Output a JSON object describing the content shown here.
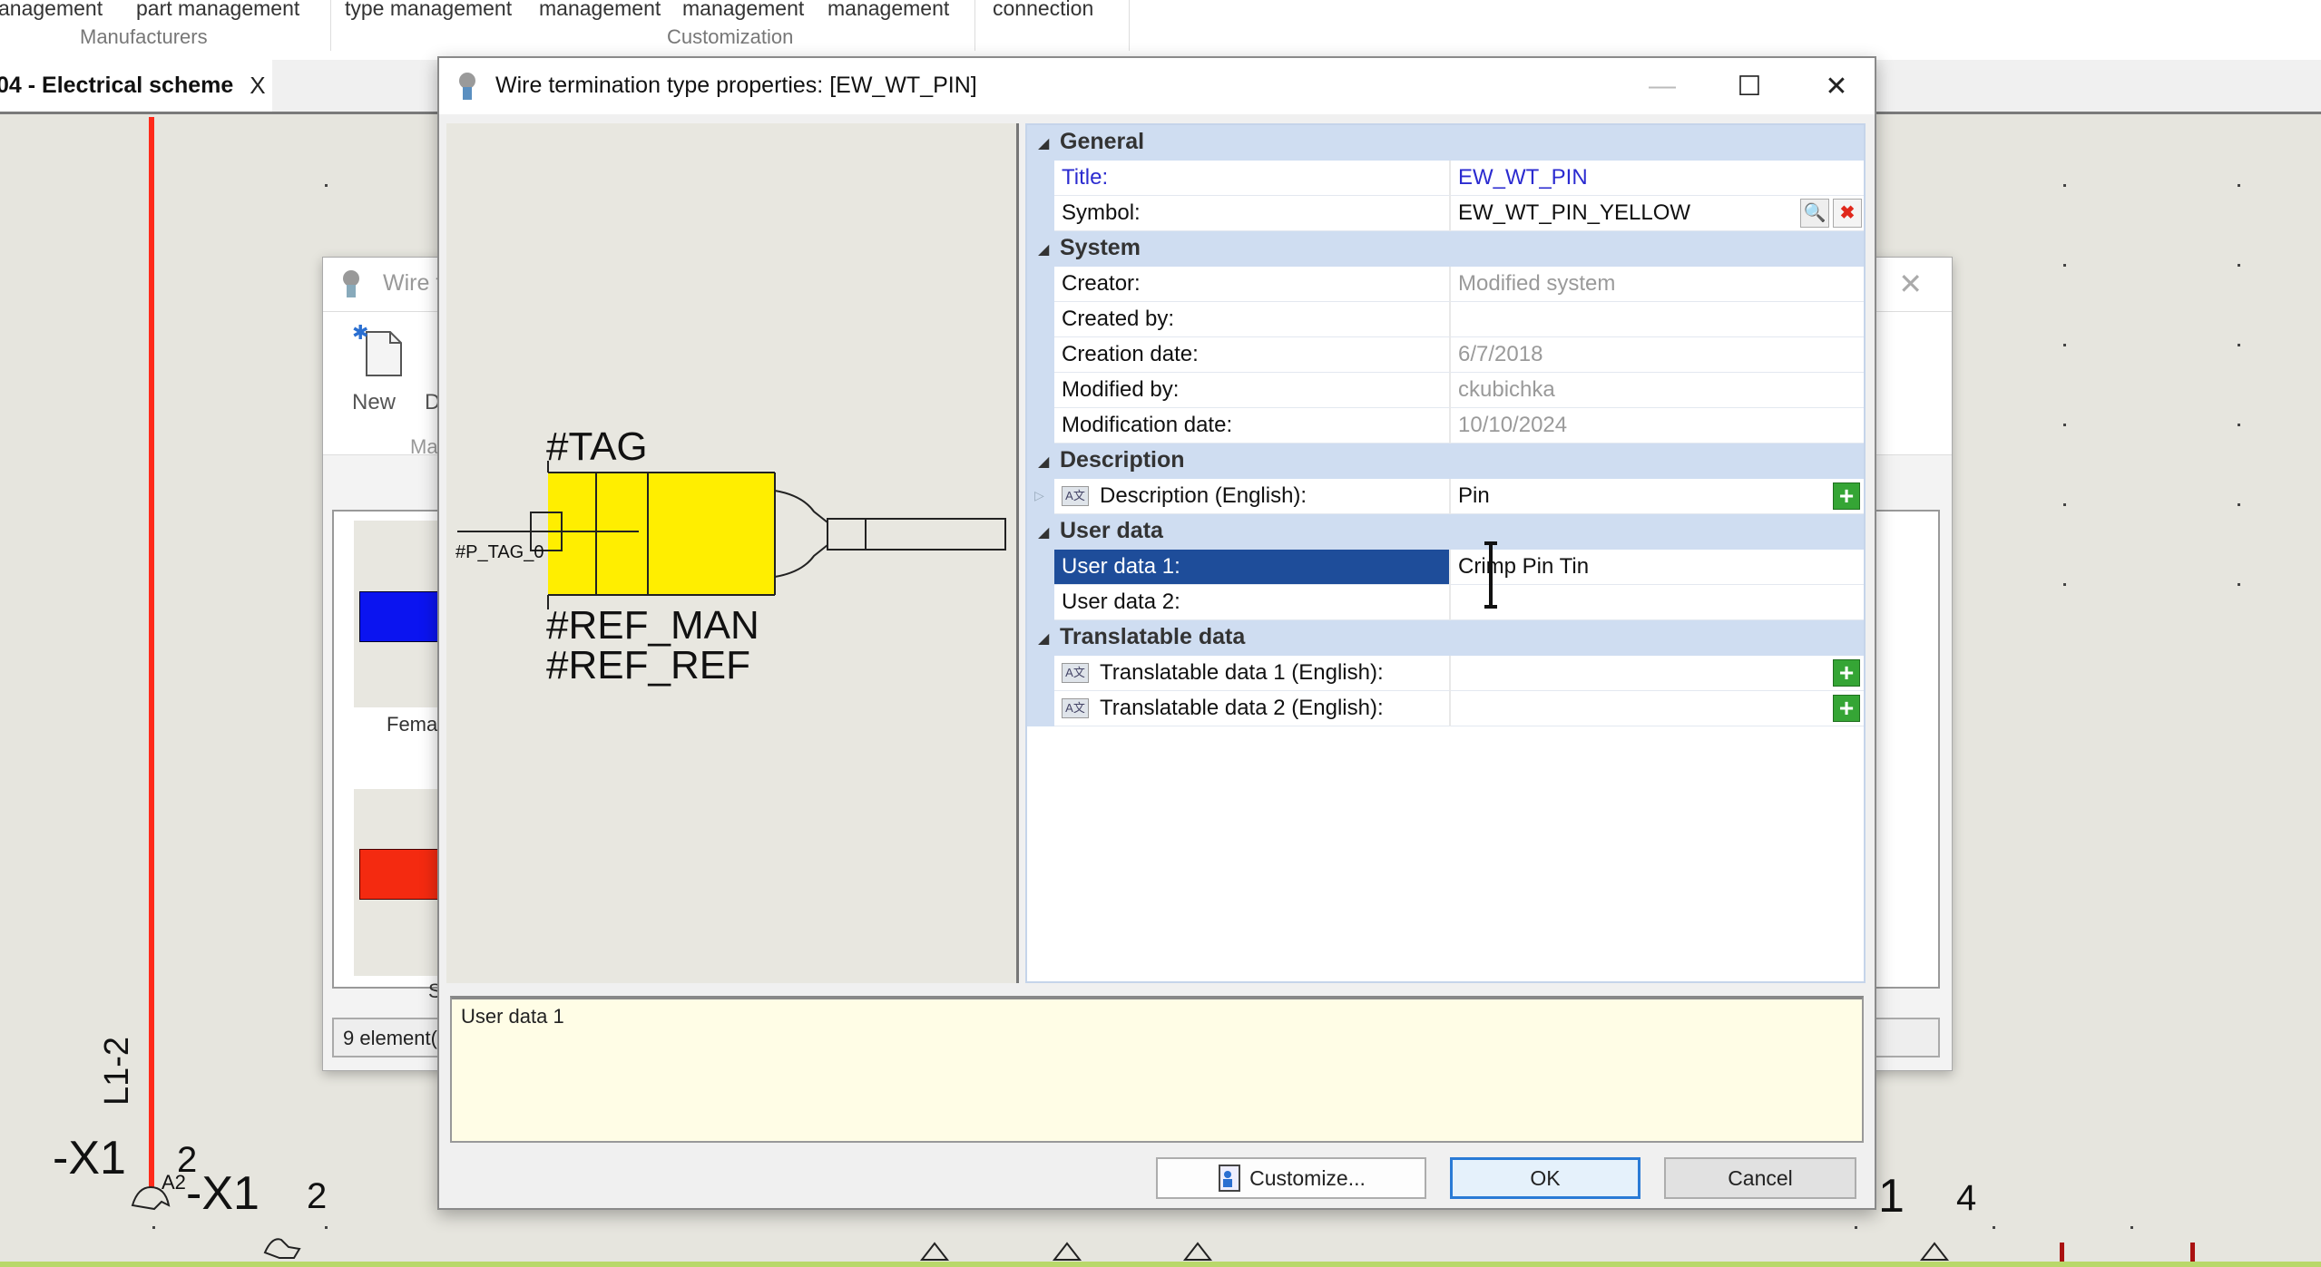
{
  "ribbon": {
    "labels": [
      "anagement",
      "part management",
      "type management",
      "management",
      "management",
      "management",
      "connection"
    ],
    "groups": [
      "Manufacturers",
      "Customization"
    ]
  },
  "doc_tab": {
    "title": "04 - Electrical scheme",
    "close": "X"
  },
  "schematic": {
    "wire_label": "L1-2",
    "labels": [
      "-X1",
      "2",
      "A2",
      "-X1",
      "2",
      "1",
      "4"
    ]
  },
  "background_dialog": {
    "title": "Wire t",
    "new_label": "New",
    "d_label": "D",
    "group_label": "Ma",
    "items": [
      "Femal",
      "Sp"
    ],
    "status": "9 element("
  },
  "dialog": {
    "title": "Wire termination type properties: [EW_WT_PIN]",
    "window_controls": {
      "minimize": "—",
      "maximize": "☐",
      "close": "✕"
    },
    "preview": {
      "tag": "#TAG",
      "p_tag": "#P_TAG_0",
      "ref_man": "#REF_MAN",
      "ref_ref": "#REF_REF",
      "fill_color": "#ffee00"
    },
    "grid": {
      "categories": [
        {
          "name": "General",
          "rows": [
            {
              "label": "Title:",
              "value": "EW_WT_PIN",
              "style": "blue"
            },
            {
              "label": "Symbol:",
              "value": "EW_WT_PIN_YELLOW",
              "style": "symbol"
            }
          ]
        },
        {
          "name": "System",
          "rows": [
            {
              "label": "Creator:",
              "value": "Modified system",
              "style": "muted"
            },
            {
              "label": "Created by:",
              "value": "",
              "style": "muted"
            },
            {
              "label": "Creation date:",
              "value": "6/7/2018",
              "style": "muted"
            },
            {
              "label": "Modified by:",
              "value": "ckubichka",
              "style": "muted"
            },
            {
              "label": "Modification date:",
              "value": "10/10/2024",
              "style": "muted"
            }
          ]
        },
        {
          "name": "Description",
          "rows": [
            {
              "label": "Description (English):",
              "value": "Pin",
              "style": "translatable"
            }
          ]
        },
        {
          "name": "User data",
          "rows": [
            {
              "label": "User data 1:",
              "value": "Crimp Pin Tin",
              "style": "selected"
            },
            {
              "label": "User data 2:",
              "value": "",
              "style": "normal"
            }
          ]
        },
        {
          "name": "Translatable data",
          "rows": [
            {
              "label": "Translatable data 1 (English):",
              "value": "",
              "style": "translatable"
            },
            {
              "label": "Translatable data 2 (English):",
              "value": "",
              "style": "translatable"
            }
          ]
        }
      ]
    },
    "help_text": "User data 1",
    "buttons": {
      "customize": "Customize...",
      "ok": "OK",
      "cancel": "Cancel"
    }
  },
  "colors": {
    "accent_selected": "#1e4d9a",
    "category_bg": "#cfddf1",
    "wire_red": "#ff2a1a",
    "add_green": "#35a535",
    "clear_red": "#e0281c"
  }
}
